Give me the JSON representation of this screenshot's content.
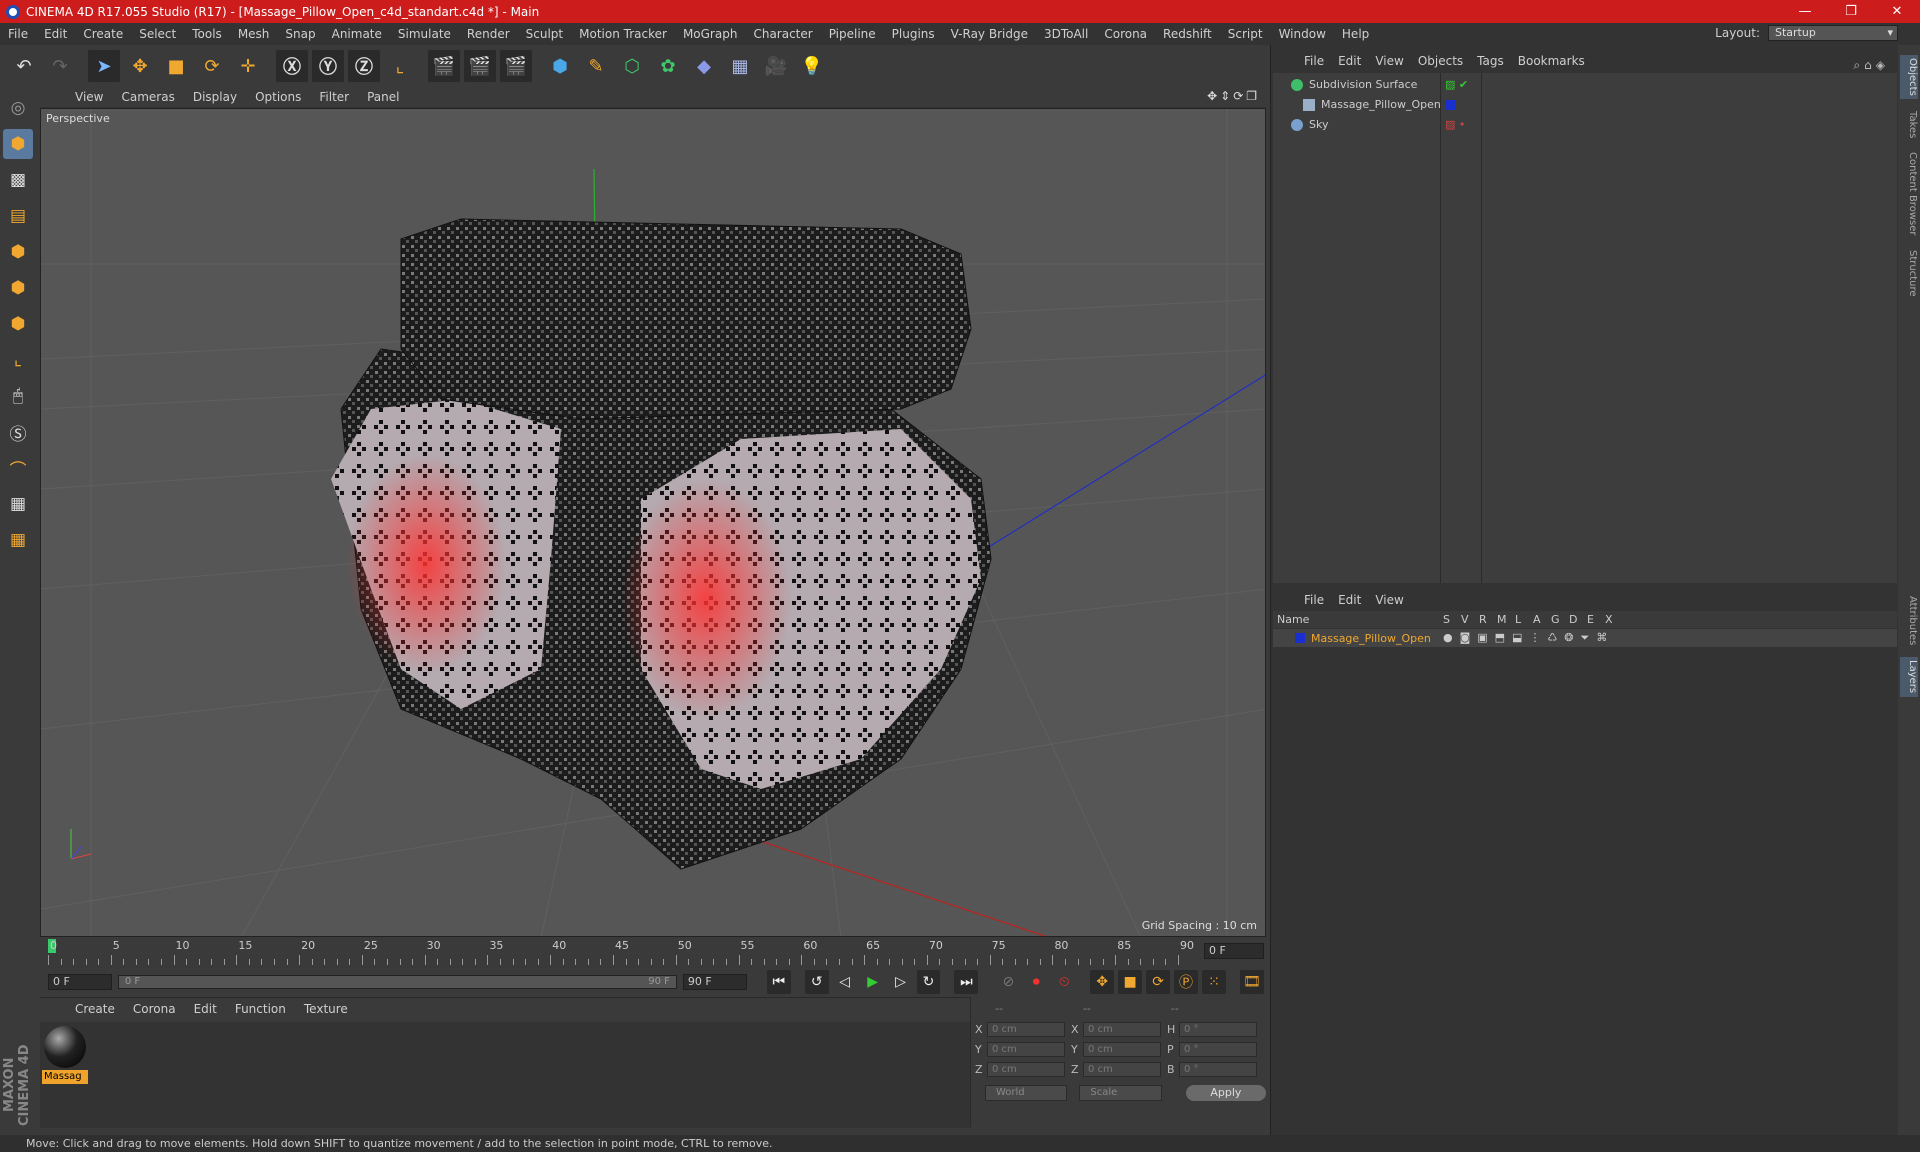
{
  "window": {
    "title": "CINEMA 4D R17.055 Studio (R17) - [Massage_Pillow_Open_c4d_standart.c4d *] - Main",
    "controls": [
      "—",
      "❐",
      "✕"
    ]
  },
  "menubar": [
    "File",
    "Edit",
    "Create",
    "Select",
    "Tools",
    "Mesh",
    "Snap",
    "Animate",
    "Simulate",
    "Render",
    "Sculpt",
    "Motion Tracker",
    "MoGraph",
    "Character",
    "Pipeline",
    "Plugins",
    "V-Ray Bridge",
    "3DToAll",
    "Corona",
    "Redshift",
    "Script",
    "Window",
    "Help"
  ],
  "layout": {
    "label": "Layout:",
    "value": "Startup"
  },
  "viewport": {
    "menu": [
      "View",
      "Cameras",
      "Display",
      "Options",
      "Filter",
      "Panel"
    ],
    "label": "Perspective",
    "grid_spacing": "Grid Spacing : 10 cm"
  },
  "timeline": {
    "labels": [
      "0",
      "5",
      "10",
      "15",
      "20",
      "25",
      "30",
      "35",
      "40",
      "45",
      "50",
      "55",
      "60",
      "65",
      "70",
      "75",
      "80",
      "85",
      "90"
    ],
    "end_frame": "0 F"
  },
  "transport": {
    "start": "0 F",
    "slider_start": "0 F",
    "slider_end": "90 F",
    "end": "90 F"
  },
  "material_panel": {
    "menu": [
      "Create",
      "Corona",
      "Edit",
      "Function",
      "Texture"
    ],
    "material_name": "Massag"
  },
  "coords": {
    "headers": [
      "--",
      "--",
      "--"
    ],
    "rows": [
      {
        "a1": "X",
        "v1": "0 cm",
        "a2": "X",
        "v2": "0 cm",
        "a3": "H",
        "v3": "0 °"
      },
      {
        "a1": "Y",
        "v1": "0 cm",
        "a2": "Y",
        "v2": "0 cm",
        "a3": "P",
        "v3": "0 °"
      },
      {
        "a1": "Z",
        "v1": "0 cm",
        "a2": "Z",
        "v2": "0 cm",
        "a3": "B",
        "v3": "0 °"
      }
    ],
    "mode1": "World",
    "mode2": "Scale",
    "apply": "Apply"
  },
  "objects": {
    "menu": [
      "File",
      "Edit",
      "View",
      "Objects",
      "Tags",
      "Bookmarks"
    ],
    "items": [
      {
        "name": "Subdivision Surface",
        "color": "#3fbf6a"
      },
      {
        "name": "Massage_Pillow_Open",
        "color": "#9ab0c8"
      },
      {
        "name": "Sky",
        "color": "#7aa0d0"
      }
    ]
  },
  "layers": {
    "menu": [
      "File",
      "Edit",
      "View"
    ],
    "headers": {
      "name": "Name",
      "cols": [
        "S",
        "V",
        "R",
        "M",
        "L",
        "A",
        "G",
        "D",
        "E",
        "X"
      ]
    },
    "row": {
      "name": "Massage_Pillow_Open",
      "color": "#1a2fd0"
    }
  },
  "sidetabs": [
    "Objects",
    "Takes",
    "Content Browser",
    "Structure",
    "Attributes",
    "Layers"
  ],
  "status": "Move: Click and drag to move elements. Hold down SHIFT to quantize movement / add to the selection in point mode, CTRL to remove."
}
